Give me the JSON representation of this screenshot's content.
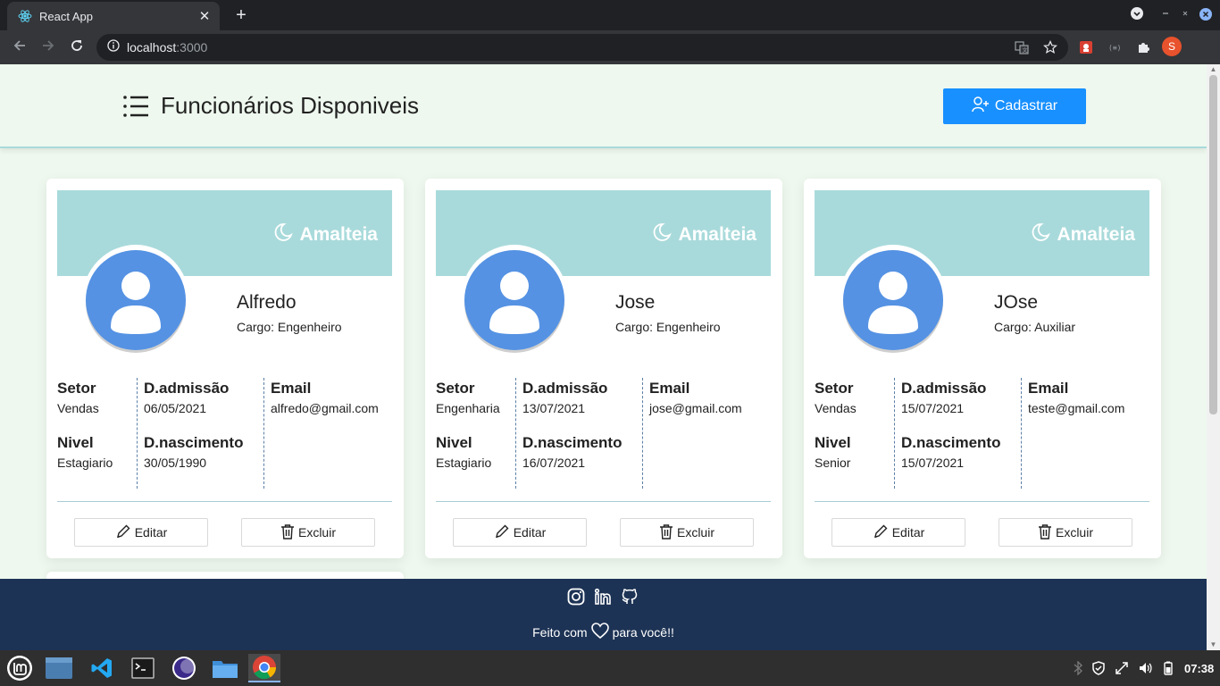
{
  "browser": {
    "tab_title": "React App",
    "url_host": "localhost",
    "url_port": ":3000",
    "profile_initial": "S"
  },
  "header": {
    "title": "Funcionários Disponiveis",
    "register_label": "Cadastrar"
  },
  "labels": {
    "brand": "Amalteia",
    "sector": "Setor",
    "admission": "D.admissão",
    "email": "Email",
    "level": "Nivel",
    "birth": "D.nascimento",
    "edit": "Editar",
    "delete": "Excluir"
  },
  "employees": [
    {
      "name": "Alfredo",
      "cargo": "Cargo: Engenheiro",
      "setor": "Vendas",
      "admissao": "06/05/2021",
      "email": "alfredo@gmail.com",
      "nivel": "Estagiario",
      "nascimento": "30/05/1990"
    },
    {
      "name": "Jose",
      "cargo": "Cargo: Engenheiro",
      "setor": "Engenharia",
      "admissao": "13/07/2021",
      "email": "jose@gmail.com",
      "nivel": "Estagiario",
      "nascimento": "16/07/2021"
    },
    {
      "name": "JOse",
      "cargo": "Cargo: Auxiliar",
      "setor": "Vendas",
      "admissao": "15/07/2021",
      "email": "teste@gmail.com",
      "nivel": "Senior",
      "nascimento": "15/07/2021"
    }
  ],
  "footer": {
    "made_prefix": "Feito com",
    "made_suffix": "para você!!"
  },
  "taskbar": {
    "clock": "07:38"
  },
  "colors": {
    "accent": "#1890ff",
    "banner": "#a9dadb",
    "avatar": "#5592e3",
    "footer": "#1d3355"
  }
}
